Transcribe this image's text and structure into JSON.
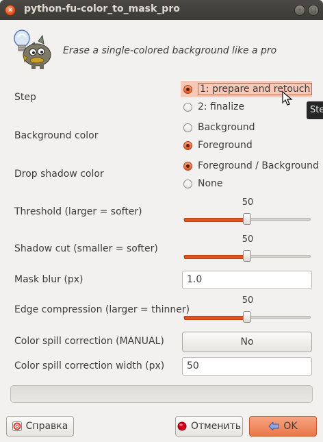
{
  "window": {
    "title": "python-fu-color_to_mask_pro",
    "close_glyph": "×",
    "minimize_glyph": "–",
    "maximize_glyph": "□"
  },
  "header": {
    "description": "Erase a single-colored background like a pro",
    "icon": "gimp-wilber-lightbulb-icon"
  },
  "step": {
    "label": "Step",
    "options": [
      {
        "label": "1: prepare and retouch",
        "checked": true,
        "focused": true
      },
      {
        "label": "2: finalize",
        "checked": false
      }
    ]
  },
  "background_color": {
    "label": "Background color",
    "options": [
      {
        "label": "Background",
        "checked": false
      },
      {
        "label": "Foreground",
        "checked": true
      }
    ]
  },
  "drop_shadow_color": {
    "label": "Drop shadow color",
    "options": [
      {
        "label": "Foreground / Background",
        "checked": true
      },
      {
        "label": "None",
        "checked": false
      }
    ]
  },
  "threshold": {
    "label": "Threshold (larger = softer)",
    "value": "50",
    "fraction": 0.5
  },
  "shadow_cut": {
    "label": "Shadow cut (smaller = softer)",
    "value": "50",
    "fraction": 0.5
  },
  "mask_blur": {
    "label": "Mask blur (px)",
    "value": "1.0"
  },
  "edge_compression": {
    "label": "Edge compression (larger = thinner)",
    "value": "50",
    "fraction": 0.5
  },
  "color_spill": {
    "label": "Color spill correction (MANUAL)",
    "button": "No"
  },
  "color_spill_width": {
    "label": "Color spill correction width (px)",
    "value": "50"
  },
  "tooltip": {
    "text": "Step"
  },
  "footer": {
    "help": "Справка",
    "cancel": "Отменить",
    "ok": "OK"
  },
  "colors": {
    "accent": "#e2541f",
    "titlebar": "#3c3b37",
    "window_bg": "#f2f1f0"
  }
}
